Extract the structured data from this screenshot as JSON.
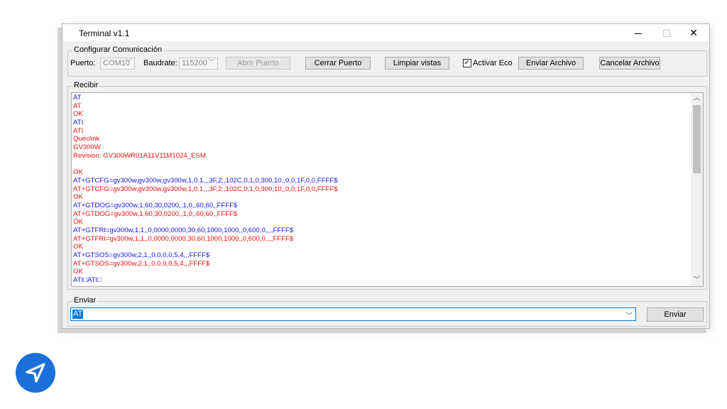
{
  "window": {
    "title": "Terminal v1.1"
  },
  "config": {
    "legend": "Configurar Comunicación",
    "port_label": "Puerto:",
    "port_value": "COM10",
    "baud_label": "Baudrate:",
    "baud_value": "115200",
    "open_port": "Abrir Puerto",
    "close_port": "Cerrar Puerto",
    "clear_views": "Limpiar vistas",
    "echo_label": "Activar Eco",
    "echo_checked": true,
    "send_file": "Enviar Archivo",
    "cancel_file": "Cancelar Archivo"
  },
  "receive": {
    "legend": "Recibir",
    "lines": [
      {
        "text": "AT",
        "color": "blue"
      },
      {
        "text": "AT",
        "color": "red"
      },
      {
        "text": "OK",
        "color": "red"
      },
      {
        "text": "ATI",
        "color": "blue"
      },
      {
        "text": "ATI",
        "color": "red"
      },
      {
        "text": "Queclink",
        "color": "red"
      },
      {
        "text": "GV300W",
        "color": "red"
      },
      {
        "text": "Revision: GV300WR01A11V11M1024_ESM",
        "color": "red"
      },
      {
        "text": "",
        "color": "red"
      },
      {
        "text": "OK",
        "color": "red"
      },
      {
        "text": "AT+GTCFG=gv300w,gv300w,gv300w,1,0.1,,,3F,2,,102C,0,1,0,300,10,,0,0,1F,0,0,FFFF$",
        "color": "blue"
      },
      {
        "text": "AT+GTCFG=gv300w,gv300w,gv300w,1,0.1,,,3F,2,,102C,0,1,0,300,10,,0,0,1F,0,0,FFFF$",
        "color": "red"
      },
      {
        "text": "OK",
        "color": "red"
      },
      {
        "text": "AT+GTDOG=gv300w,1,60,30,0200,,1,0,,60,60,,FFFF$",
        "color": "blue"
      },
      {
        "text": "AT+GTDOG=gv300w,1,60,30,0200,,1,0,,60,60,,FFFF$",
        "color": "red"
      },
      {
        "text": "OK",
        "color": "red"
      },
      {
        "text": "AT+GTFRI=gv300w,1,1,,0,0000,0000,30,60,1000,1000,,0,600,0,,,,FFFF$",
        "color": "blue"
      },
      {
        "text": "AT+GTFRI=gv300w,1,1,,0,0000,0000,30,60,1000,1000,,0,600,0,,,,FFFF$",
        "color": "red"
      },
      {
        "text": "OK",
        "color": "red"
      },
      {
        "text": "AT+GTSOS=gv300w,2,1,,0,0,0,0,5,4,,,FFFF$",
        "color": "blue"
      },
      {
        "text": "AT+GTSOS=gv300w,2,1,,0,0,0,0,5,4,,,FFFF$",
        "color": "red"
      },
      {
        "text": "OK",
        "color": "red"
      },
      {
        "text": "ATI□ATI□",
        "color": "blue"
      }
    ]
  },
  "send": {
    "legend": "Enviar",
    "input_value": "AT",
    "send_button": "Enviar"
  },
  "colors": {
    "blue": "#1515e8",
    "red": "#f01010",
    "selection": "#0078d7",
    "fab": "#1a6fd8"
  },
  "icons": {
    "fab": "send-navigation-icon"
  }
}
